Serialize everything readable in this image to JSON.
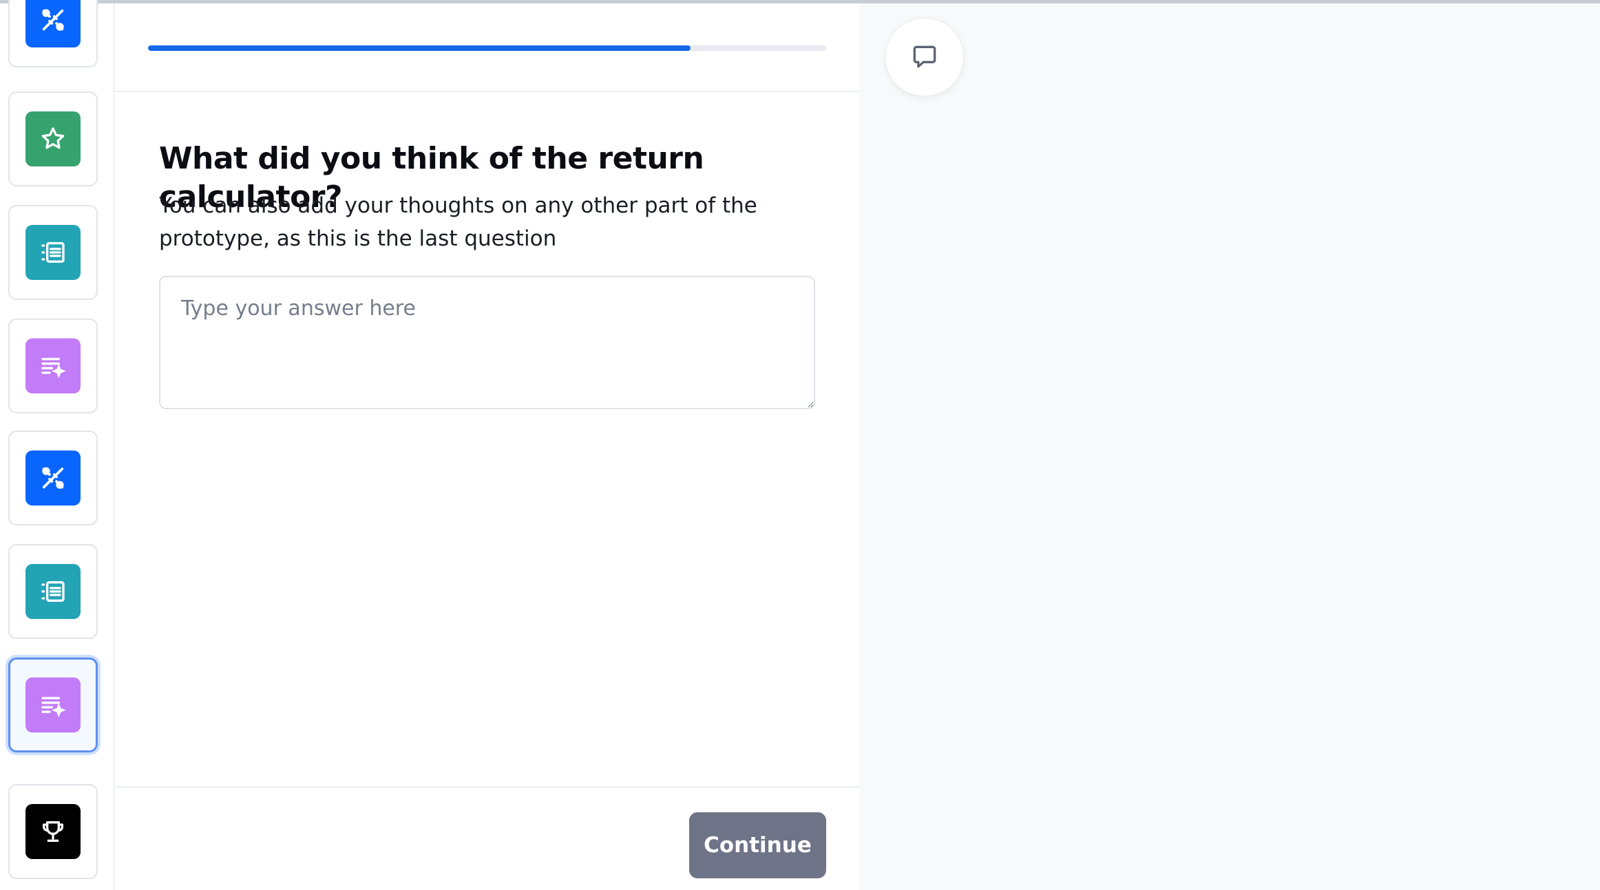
{
  "survey": {
    "progress_percent": 80
  },
  "sidebar": {
    "items": [
      {
        "type": "prototype",
        "icon": "prototype-test-icon",
        "color": "#0866ff",
        "active": false
      },
      {
        "type": "rating",
        "icon": "star-icon",
        "color": "#36a36f",
        "active": false
      },
      {
        "type": "list",
        "icon": "list-icon",
        "color": "#23a4b5",
        "active": false
      },
      {
        "type": "open-question",
        "icon": "text-sparkle-icon",
        "color": "#c27cf7",
        "active": false
      },
      {
        "type": "prototype",
        "icon": "prototype-test-icon",
        "color": "#0866ff",
        "active": false
      },
      {
        "type": "list",
        "icon": "list-icon",
        "color": "#23a4b5",
        "active": false
      },
      {
        "type": "open-question",
        "icon": "text-sparkle-icon",
        "color": "#c27cf7",
        "active": true
      },
      {
        "type": "thank-you",
        "icon": "trophy-icon",
        "color": "#000000",
        "active": false
      }
    ]
  },
  "question": {
    "title": "What did you think of the return calculator?",
    "description": "You can also add your thoughts on any other part of the prototype, as this is the last question",
    "placeholder": "Type your answer here",
    "value": ""
  },
  "footer": {
    "continue_label": "Continue",
    "continue_color": "#6e7388"
  },
  "accent_color": "#1769e8",
  "comment_button": {
    "icon": "comment-icon"
  }
}
